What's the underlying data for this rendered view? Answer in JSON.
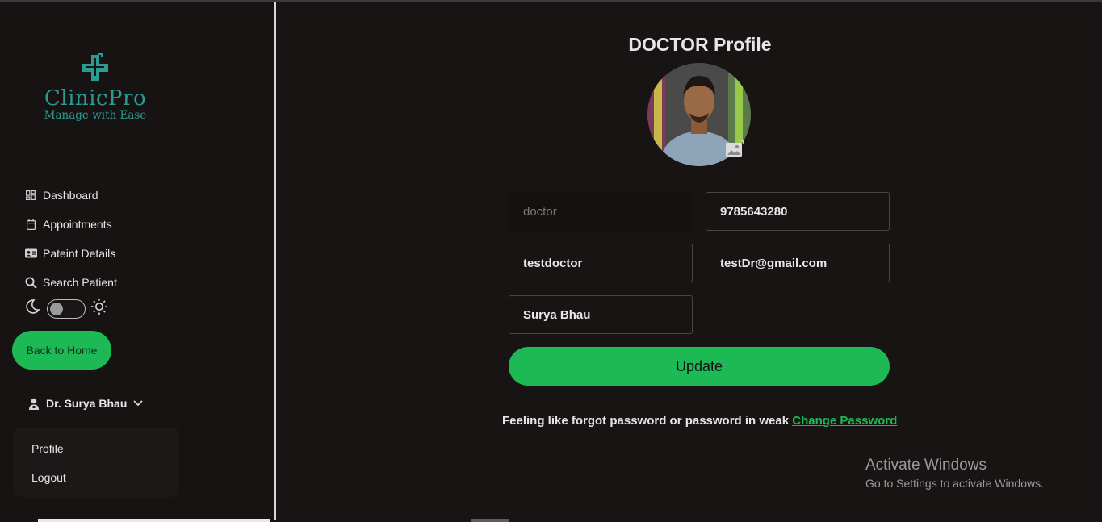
{
  "brand": {
    "name": "ClinicPro",
    "tagline": "Manage with Ease",
    "color": "#2a9c94"
  },
  "sidebar": {
    "items": [
      {
        "label": "Dashboard",
        "icon": "dashboard-icon"
      },
      {
        "label": "Appointments",
        "icon": "calendar-icon"
      },
      {
        "label": "Pateint Details",
        "icon": "id-card-icon"
      },
      {
        "label": "Search Patient",
        "icon": "search-icon"
      }
    ],
    "theme_toggle": {
      "left_icon": "moon-icon",
      "right_icon": "sun-icon",
      "state": "off"
    },
    "back_button": "Back to Home",
    "user": {
      "name": "Dr. Surya Bhau",
      "icon": "user-icon"
    },
    "dropdown": [
      {
        "label": "Profile"
      },
      {
        "label": "Logout"
      }
    ]
  },
  "main": {
    "title": "DOCTOR Profile",
    "fields": {
      "role": {
        "value": "doctor",
        "disabled": true
      },
      "phone": {
        "value": "9785643280"
      },
      "username": {
        "value": "testdoctor"
      },
      "email": {
        "value": "testDr@gmail.com"
      },
      "full_name": {
        "value": "Surya Bhau"
      }
    },
    "update_button": "Update",
    "password_prompt": "Feeling like forgot password or password in weak",
    "change_password_link": "Change Password"
  },
  "windows_watermark": {
    "title": "Activate Windows",
    "subtitle": "Go to Settings to activate Windows."
  },
  "colors": {
    "accent": "#1db954",
    "background": "#181414",
    "sidebar": "#171313"
  }
}
